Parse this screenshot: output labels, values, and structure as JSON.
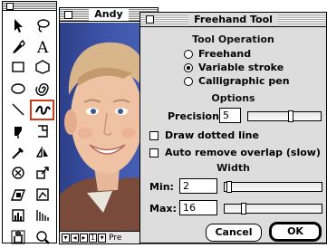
{
  "document": {
    "title": "Andy",
    "page_number": "1",
    "status_text": "Pre"
  },
  "toolbox": {
    "tools": [
      {
        "name": "pointer-tool-icon",
        "active": false
      },
      {
        "name": "lasso-tool-icon",
        "active": false
      },
      {
        "name": "pen-tool-icon",
        "active": false
      },
      {
        "name": "text-tool-icon",
        "active": false
      },
      {
        "name": "rectangle-tool-icon",
        "active": false
      },
      {
        "name": "polygon-tool-icon",
        "active": false
      },
      {
        "name": "ellipse-tool-icon",
        "active": false
      },
      {
        "name": "spiral-tool-icon",
        "active": false
      },
      {
        "name": "line-tool-icon",
        "active": false
      },
      {
        "name": "freehand-tool-icon",
        "active": true
      },
      {
        "name": "bezigon-tool-icon",
        "active": false
      },
      {
        "name": "knife-tool-icon",
        "active": false
      },
      {
        "name": "eyedropper-tool-icon",
        "active": false
      },
      {
        "name": "reflect-tool-icon",
        "active": false
      },
      {
        "name": "rotate-tool-icon",
        "active": false
      },
      {
        "name": "scale-tool-icon",
        "active": false
      },
      {
        "name": "skew-tool-icon",
        "active": false
      },
      {
        "name": "trace-tool-icon",
        "active": false
      },
      {
        "name": "chart-tool-icon",
        "active": false
      },
      {
        "name": "blend-tool-icon",
        "active": false
      },
      {
        "name": "hand-tool-icon",
        "active": false
      },
      {
        "name": "zoom-tool-icon",
        "active": false
      }
    ]
  },
  "dialog": {
    "title": "Freehand Tool",
    "tool_operation": {
      "heading": "Tool Operation",
      "options": [
        {
          "label": "Freehand",
          "selected": false
        },
        {
          "label": "Variable stroke",
          "selected": true
        },
        {
          "label": "Calligraphic pen",
          "selected": false
        }
      ]
    },
    "options": {
      "heading": "Options",
      "precision_label": "Precision:",
      "precision_value": "5",
      "precision_slider_fraction": 0.6,
      "draw_dotted_line_label": "Draw dotted line",
      "draw_dotted_line_checked": false,
      "auto_remove_overlap_label": "Auto remove overlap (slow)",
      "auto_remove_overlap_checked": false
    },
    "width": {
      "heading": "Width",
      "min_label": "Min:",
      "min_value": "2",
      "min_slider_fraction": 0.02,
      "max_label": "Max:",
      "max_value": "16",
      "max_slider_fraction": 0.18
    },
    "buttons": {
      "cancel": "Cancel",
      "ok": "OK"
    }
  },
  "colors": {
    "active_tool_highlight": "#d23a1b",
    "dialog_background": "#dddddd"
  }
}
